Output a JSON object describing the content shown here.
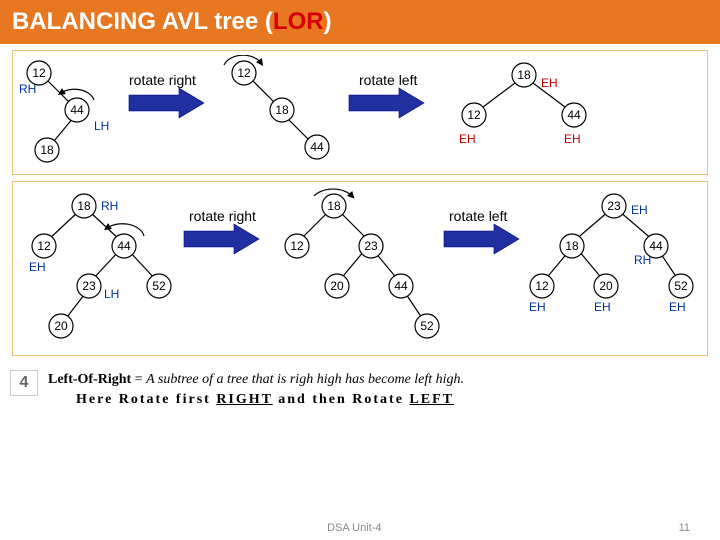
{
  "title": {
    "main": "BALANCING AVL tree ",
    "paren_open": "(",
    "lor": "LOR",
    "paren_close": ")"
  },
  "fig1": {
    "s1": {
      "n1": "12",
      "n2": "44",
      "n3": "18",
      "t1": "RH",
      "t2": "LH"
    },
    "op1": "rotate right",
    "s2": {
      "n1": "12",
      "n2": "18",
      "n3": "44"
    },
    "op2": "rotate left",
    "s3": {
      "n1": "18",
      "n2": "12",
      "n3": "44",
      "t1": "EH",
      "t2": "EH",
      "t3": "EH"
    }
  },
  "fig2": {
    "s1": {
      "n18": "18",
      "n12": "12",
      "n44": "44",
      "n23": "23",
      "n52": "52",
      "n20": "20",
      "tRH": "RH",
      "tEH": "EH",
      "tLH": "LH"
    },
    "op1": "rotate right",
    "s2": {
      "n18": "18",
      "n12": "12",
      "n23": "23",
      "n20": "20",
      "n44": "44",
      "n52": "52"
    },
    "op2": "rotate left",
    "s3": {
      "n23": "23",
      "n18": "18",
      "n44": "44",
      "n12": "12",
      "n20": "20",
      "n52": "52",
      "tEH": "EH",
      "tRH": "RH"
    }
  },
  "caption": {
    "num": "4",
    "term": "Left-Of-Right",
    "eq": " = ",
    "desc": "A subtree of a tree that is righ high has become left high.",
    "action_pre": "Here Rotate first ",
    "right": "RIGHT",
    "mid": " and then Rotate ",
    "left": "LEFT"
  },
  "footer": {
    "center": "DSA Unit-4",
    "right": "11"
  }
}
